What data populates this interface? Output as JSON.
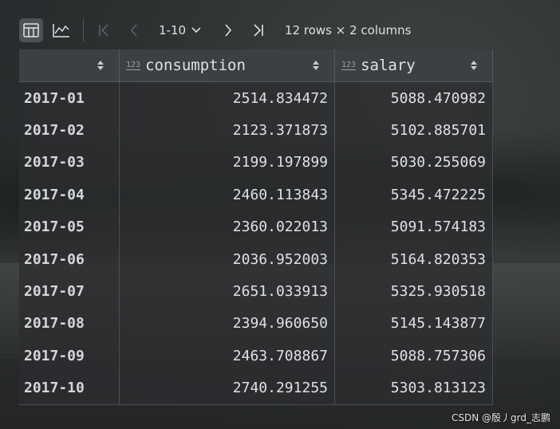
{
  "toolbar": {
    "page_range": "1-10",
    "row_info": "12 rows × 2 columns"
  },
  "table": {
    "columns": [
      {
        "label": "",
        "type_badge": ""
      },
      {
        "label": "consumption",
        "type_badge": "123"
      },
      {
        "label": "salary",
        "type_badge": "123"
      }
    ],
    "rows": [
      {
        "index": "2017-01",
        "consumption": "2514.834472",
        "salary": "5088.470982"
      },
      {
        "index": "2017-02",
        "consumption": "2123.371873",
        "salary": "5102.885701"
      },
      {
        "index": "2017-03",
        "consumption": "2199.197899",
        "salary": "5030.255069"
      },
      {
        "index": "2017-04",
        "consumption": "2460.113843",
        "salary": "5345.472225"
      },
      {
        "index": "2017-05",
        "consumption": "2360.022013",
        "salary": "5091.574183"
      },
      {
        "index": "2017-06",
        "consumption": "2036.952003",
        "salary": "5164.820353"
      },
      {
        "index": "2017-07",
        "consumption": "2651.033913",
        "salary": "5325.930518"
      },
      {
        "index": "2017-08",
        "consumption": "2394.960650",
        "salary": "5145.143877"
      },
      {
        "index": "2017-09",
        "consumption": "2463.708867",
        "salary": "5088.757306"
      },
      {
        "index": "2017-10",
        "consumption": "2740.291255",
        "salary": "5303.813123"
      }
    ]
  },
  "watermark": "CSDN @殷丿grd_志鹏",
  "icons": [
    "table-view-icon",
    "chart-view-icon",
    "first-page-icon",
    "previous-page-icon",
    "chevron-down-icon",
    "next-page-icon",
    "last-page-icon",
    "sort-icon"
  ],
  "colors": {
    "background": "#2b2d30",
    "header": "#3c3f43",
    "text": "#dfe1e5",
    "active_button": "#4e5157"
  }
}
